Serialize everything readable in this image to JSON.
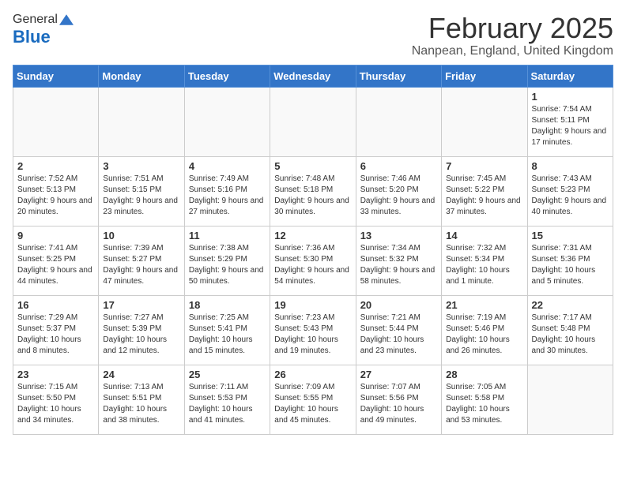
{
  "header": {
    "logo_general": "General",
    "logo_blue": "Blue",
    "month_title": "February 2025",
    "location": "Nanpean, England, United Kingdom"
  },
  "days_of_week": [
    "Sunday",
    "Monday",
    "Tuesday",
    "Wednesday",
    "Thursday",
    "Friday",
    "Saturday"
  ],
  "weeks": [
    [
      {
        "day": "",
        "info": ""
      },
      {
        "day": "",
        "info": ""
      },
      {
        "day": "",
        "info": ""
      },
      {
        "day": "",
        "info": ""
      },
      {
        "day": "",
        "info": ""
      },
      {
        "day": "",
        "info": ""
      },
      {
        "day": "1",
        "info": "Sunrise: 7:54 AM\nSunset: 5:11 PM\nDaylight: 9 hours and 17 minutes."
      }
    ],
    [
      {
        "day": "2",
        "info": "Sunrise: 7:52 AM\nSunset: 5:13 PM\nDaylight: 9 hours and 20 minutes."
      },
      {
        "day": "3",
        "info": "Sunrise: 7:51 AM\nSunset: 5:15 PM\nDaylight: 9 hours and 23 minutes."
      },
      {
        "day": "4",
        "info": "Sunrise: 7:49 AM\nSunset: 5:16 PM\nDaylight: 9 hours and 27 minutes."
      },
      {
        "day": "5",
        "info": "Sunrise: 7:48 AM\nSunset: 5:18 PM\nDaylight: 9 hours and 30 minutes."
      },
      {
        "day": "6",
        "info": "Sunrise: 7:46 AM\nSunset: 5:20 PM\nDaylight: 9 hours and 33 minutes."
      },
      {
        "day": "7",
        "info": "Sunrise: 7:45 AM\nSunset: 5:22 PM\nDaylight: 9 hours and 37 minutes."
      },
      {
        "day": "8",
        "info": "Sunrise: 7:43 AM\nSunset: 5:23 PM\nDaylight: 9 hours and 40 minutes."
      }
    ],
    [
      {
        "day": "9",
        "info": "Sunrise: 7:41 AM\nSunset: 5:25 PM\nDaylight: 9 hours and 44 minutes."
      },
      {
        "day": "10",
        "info": "Sunrise: 7:39 AM\nSunset: 5:27 PM\nDaylight: 9 hours and 47 minutes."
      },
      {
        "day": "11",
        "info": "Sunrise: 7:38 AM\nSunset: 5:29 PM\nDaylight: 9 hours and 50 minutes."
      },
      {
        "day": "12",
        "info": "Sunrise: 7:36 AM\nSunset: 5:30 PM\nDaylight: 9 hours and 54 minutes."
      },
      {
        "day": "13",
        "info": "Sunrise: 7:34 AM\nSunset: 5:32 PM\nDaylight: 9 hours and 58 minutes."
      },
      {
        "day": "14",
        "info": "Sunrise: 7:32 AM\nSunset: 5:34 PM\nDaylight: 10 hours and 1 minute."
      },
      {
        "day": "15",
        "info": "Sunrise: 7:31 AM\nSunset: 5:36 PM\nDaylight: 10 hours and 5 minutes."
      }
    ],
    [
      {
        "day": "16",
        "info": "Sunrise: 7:29 AM\nSunset: 5:37 PM\nDaylight: 10 hours and 8 minutes."
      },
      {
        "day": "17",
        "info": "Sunrise: 7:27 AM\nSunset: 5:39 PM\nDaylight: 10 hours and 12 minutes."
      },
      {
        "day": "18",
        "info": "Sunrise: 7:25 AM\nSunset: 5:41 PM\nDaylight: 10 hours and 15 minutes."
      },
      {
        "day": "19",
        "info": "Sunrise: 7:23 AM\nSunset: 5:43 PM\nDaylight: 10 hours and 19 minutes."
      },
      {
        "day": "20",
        "info": "Sunrise: 7:21 AM\nSunset: 5:44 PM\nDaylight: 10 hours and 23 minutes."
      },
      {
        "day": "21",
        "info": "Sunrise: 7:19 AM\nSunset: 5:46 PM\nDaylight: 10 hours and 26 minutes."
      },
      {
        "day": "22",
        "info": "Sunrise: 7:17 AM\nSunset: 5:48 PM\nDaylight: 10 hours and 30 minutes."
      }
    ],
    [
      {
        "day": "23",
        "info": "Sunrise: 7:15 AM\nSunset: 5:50 PM\nDaylight: 10 hours and 34 minutes."
      },
      {
        "day": "24",
        "info": "Sunrise: 7:13 AM\nSunset: 5:51 PM\nDaylight: 10 hours and 38 minutes."
      },
      {
        "day": "25",
        "info": "Sunrise: 7:11 AM\nSunset: 5:53 PM\nDaylight: 10 hours and 41 minutes."
      },
      {
        "day": "26",
        "info": "Sunrise: 7:09 AM\nSunset: 5:55 PM\nDaylight: 10 hours and 45 minutes."
      },
      {
        "day": "27",
        "info": "Sunrise: 7:07 AM\nSunset: 5:56 PM\nDaylight: 10 hours and 49 minutes."
      },
      {
        "day": "28",
        "info": "Sunrise: 7:05 AM\nSunset: 5:58 PM\nDaylight: 10 hours and 53 minutes."
      },
      {
        "day": "",
        "info": ""
      }
    ]
  ]
}
